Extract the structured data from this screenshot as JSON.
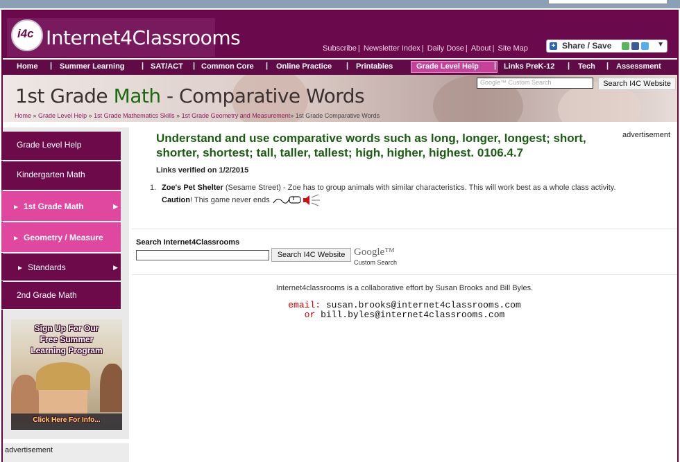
{
  "site": {
    "name": "Internet4Classrooms",
    "logo_badge": "i4c"
  },
  "top_links": [
    "Subscribe",
    "Newsletter Index",
    "Daily Dose",
    "About",
    "Site Map"
  ],
  "share": {
    "label": "Share / Save"
  },
  "nav": {
    "items": [
      "Home",
      "Summer Learning",
      "SAT/ACT",
      "Common Core",
      "Online Practice",
      "Printables",
      "Grade Level Help",
      "Links PreK-12",
      "Tech",
      "Assessment"
    ],
    "active": "Grade Level Help"
  },
  "banner": {
    "title_prefix": "1st Grade ",
    "title_highlight": "Math",
    "title_suffix": " - Comparative Words",
    "search_placeholder": "Google™ Custom Search",
    "search_button": "Search I4C Website",
    "breadcrumbs": [
      "Home",
      "Grade Level Help",
      "1st Grade Mathematics Skills",
      "1st Grade Geometry and Measurement",
      "1st Grade Comparative Words"
    ]
  },
  "sidebar": {
    "items": [
      {
        "label": "Grade Level Help",
        "style": "dark"
      },
      {
        "label": "Kindergarten Math",
        "style": "dark"
      },
      {
        "label": "1st Grade Math",
        "style": "pink"
      },
      {
        "label": "Geometry / Measure",
        "style": "pink"
      },
      {
        "label": "Standards",
        "style": "dark"
      },
      {
        "label": "2nd Grade Math",
        "style": "dark"
      }
    ],
    "promo": {
      "line1": "Sign Up For Our",
      "line2": "Free Summer",
      "line3": "Learning Program",
      "cta": "Click Here For Info..."
    },
    "advertisement": "advertisement"
  },
  "main": {
    "heading": "Understand and use comparative words such as long, longer, longest; short, shorter, shortest; tall, taller, tallest; high, higher, highest. 0106.4.7",
    "advertisement": "advertisement",
    "verified": "Links verified on 1/2/2015",
    "resources": [
      {
        "number": "1.",
        "title": "Zoe's Pet Shelter",
        "source": "(Sesame Street)",
        "description": " - Zoe has to group animals with similar characteristics. This will work best as a whole class activity.",
        "caution_label": "Caution",
        "caution_text": "! This game never ends"
      }
    ],
    "search": {
      "label": "Search Internet4Classrooms",
      "button": "Search I4C Website",
      "google": "Google™",
      "google_sub": "Custom Search"
    },
    "footer": {
      "credit": "Internet4classrooms is a collaborative effort by Susan Brooks and Bill Byles.",
      "email_label": "email:",
      "email1": "susan.brooks@internet4classrooms.com",
      "or": "or",
      "email2": "bill.byles@internet4classrooms.com"
    }
  },
  "colors": {
    "brand": "#6a0a4c",
    "pink": "#e0479f",
    "heading_green": "#1a5c12"
  }
}
